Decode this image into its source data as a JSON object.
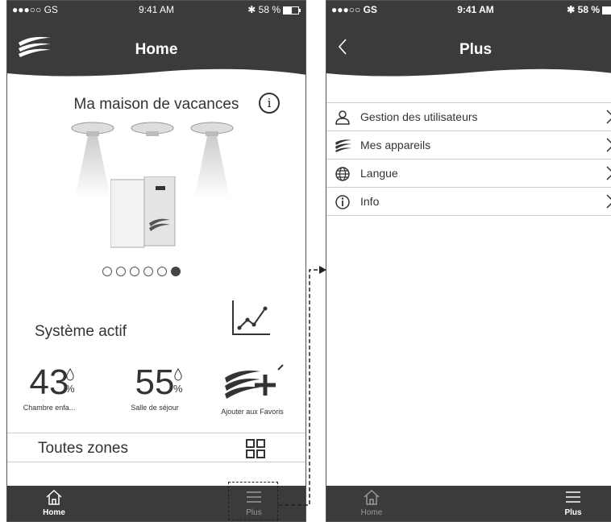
{
  "left_screen": {
    "status": {
      "carrier": "●●●○○ GS",
      "time": "9:41 AM",
      "battery": "58 %"
    },
    "header": {
      "title": "Home"
    },
    "house_name": "Ma maison de vacances",
    "system_status": "Système actif",
    "stats": [
      {
        "value": "43",
        "unit": "%",
        "caption": "Chambre enfa..."
      },
      {
        "value": "55",
        "unit": "%",
        "caption": "Salle de séjour"
      }
    ],
    "favorite_caption": "Ajouter aux Favoris",
    "zones_label": "Toutes zones",
    "pagination": {
      "count": 6,
      "active_index": 5
    },
    "tabs": [
      {
        "label": "Home"
      },
      {
        "label": "Plus"
      }
    ]
  },
  "right_screen": {
    "status": {
      "carrier": "●●●○○ GS",
      "time": "9:41 AM",
      "battery": "58 %"
    },
    "header": {
      "title": "Plus"
    },
    "menu": [
      {
        "label": "Gestion des utilisateurs",
        "icon": "user-icon"
      },
      {
        "label": "Mes appareils",
        "icon": "brand-waves-icon"
      },
      {
        "label": "Langue",
        "icon": "globe-icon"
      },
      {
        "label": "Info",
        "icon": "info-icon"
      }
    ],
    "tabs": [
      {
        "label": "Home"
      },
      {
        "label": "Plus"
      }
    ]
  },
  "colors": {
    "dark": "#3b3b3b",
    "text": "#333333",
    "divider": "#cccccc"
  }
}
